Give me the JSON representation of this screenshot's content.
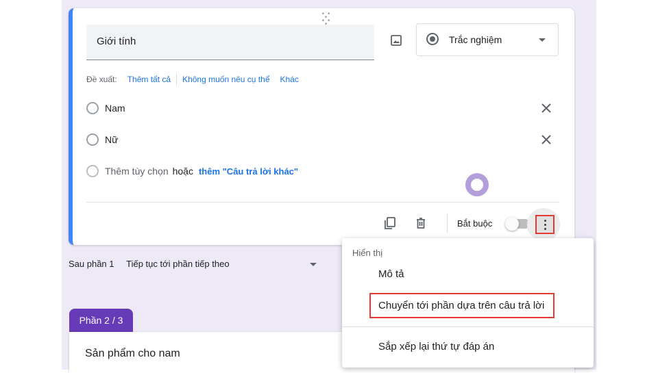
{
  "question": {
    "title": "Giới tính",
    "type_label": "Trắc nghiệm",
    "suggestions": {
      "prefix": "Đề xuất:",
      "items": [
        "Thêm tất cả",
        "Không muốn nêu cụ thể",
        "Khác"
      ]
    },
    "options": [
      "Nam",
      "Nữ"
    ],
    "add_option": "Thêm tùy chọn",
    "or_text": "hoặc",
    "add_other": "thêm \"Câu trả lời khác\"",
    "required_label": "Bắt buộc",
    "required": false
  },
  "after_section": {
    "label": "Sau phần 1",
    "value": "Tiếp tục tới phần tiếp theo"
  },
  "next_section": {
    "tab_label": "Phần 2 / 3",
    "title": "Sản phẩm cho nam"
  },
  "menu": {
    "header": "Hiển thị",
    "items": [
      "Mô tả",
      "Chuyển tới phần dựa trên câu trả lời",
      "Sắp xếp lại thứ tự đáp án"
    ]
  },
  "icons": [
    "drag-handle-icon",
    "image-icon",
    "radio-checked-icon",
    "dropdown-caret-icon",
    "close-icon",
    "copy-icon",
    "trash-icon",
    "more-vert-icon",
    "ai-assistant-icon"
  ],
  "colors": {
    "accent_blue": "#4285f4",
    "link_blue": "#1a73e8",
    "section_purple": "#673ab7",
    "background_lavender": "#eee9f6",
    "highlight_red": "#e53935"
  }
}
